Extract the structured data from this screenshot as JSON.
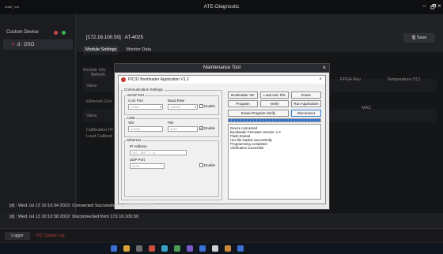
{
  "window": {
    "app_logo": "mabl_xxx",
    "title": "ATE-Diagnostic",
    "controls": [
      "–",
      "🗗",
      "×"
    ]
  },
  "sidebar": {
    "header": "Custom Device",
    "device": "d : DSO"
  },
  "main": {
    "device_title": "[172.16.100.50] : AT-4025",
    "save_label": "Save",
    "tabs": [
      "Module Settings",
      "Monitor Data"
    ],
    "refresh_label": "Refresh",
    "module_info_label": "Module Info",
    "value_label_1": "Value",
    "ethernet_label": "Ethernet Con",
    "value_label_2": "Value",
    "calibration_label": "Calibration Fil",
    "load_cal_label": "Load Calibrat",
    "fpga_rev": "FPGA Rev",
    "temperature": "Temperature (°C)",
    "mac": "MAC"
  },
  "maintenance": {
    "title": "Maintenance Tool",
    "close": "×"
  },
  "pic32": {
    "title": "PIC32 Bootloader Application V1.2",
    "close": "×",
    "comm_settings": "Communication Settings",
    "serial_port": "Serial Port",
    "com_port_label": "Com Port",
    "com_port_value": "COM1",
    "baud_rate_label": "Baud Rate",
    "baud_rate_value": "115200",
    "serial_enable": "Enable",
    "usb": "USB",
    "vid_label": "VID",
    "vid_value": "0x4D8",
    "pid_label": "PID",
    "pid_value": "0x3C",
    "usb_enable": "Enable",
    "usb_enable_checked": "✔",
    "ethernet": "Ethernet",
    "ip_label": "IP Address",
    "ip_value": "192 . 168 . 1 . 11",
    "udp_label": "UDP Port",
    "udp_value": "6234",
    "eth_enable": "Enable",
    "buttons": {
      "bootloader_ver": "Bootloader Ver",
      "load_hex": "Load Hex File",
      "erase": "Erase",
      "program": "Program",
      "verify": "Verify",
      "run_app": "Run Application",
      "erase_program_verify": "Erase-Program-Verify",
      "disconnect": "Disconnect"
    },
    "progress": 1.0,
    "status_lines": [
      "Device connected",
      "Bootloader Firmware Version: 1.4",
      "Flash Erased",
      "Hex file loaded successfully",
      "Programming completed",
      "Verification successful"
    ]
  },
  "log": {
    "line1": "[d] : Wed Jul 13 10:10:34 2022: Connected Successfully to 172.16.100.50",
    "line2": "[d] : Wed Jul 13 10:10:38 2022: Disconnected from 172.16.100.50"
  },
  "bottom": {
    "logger": "Logger",
    "red_tab": "PIC Update Log"
  },
  "colors": {
    "accent_red": "#d04545",
    "accent_green": "#3fb34f",
    "progress_blue": "#2f6fc9"
  }
}
